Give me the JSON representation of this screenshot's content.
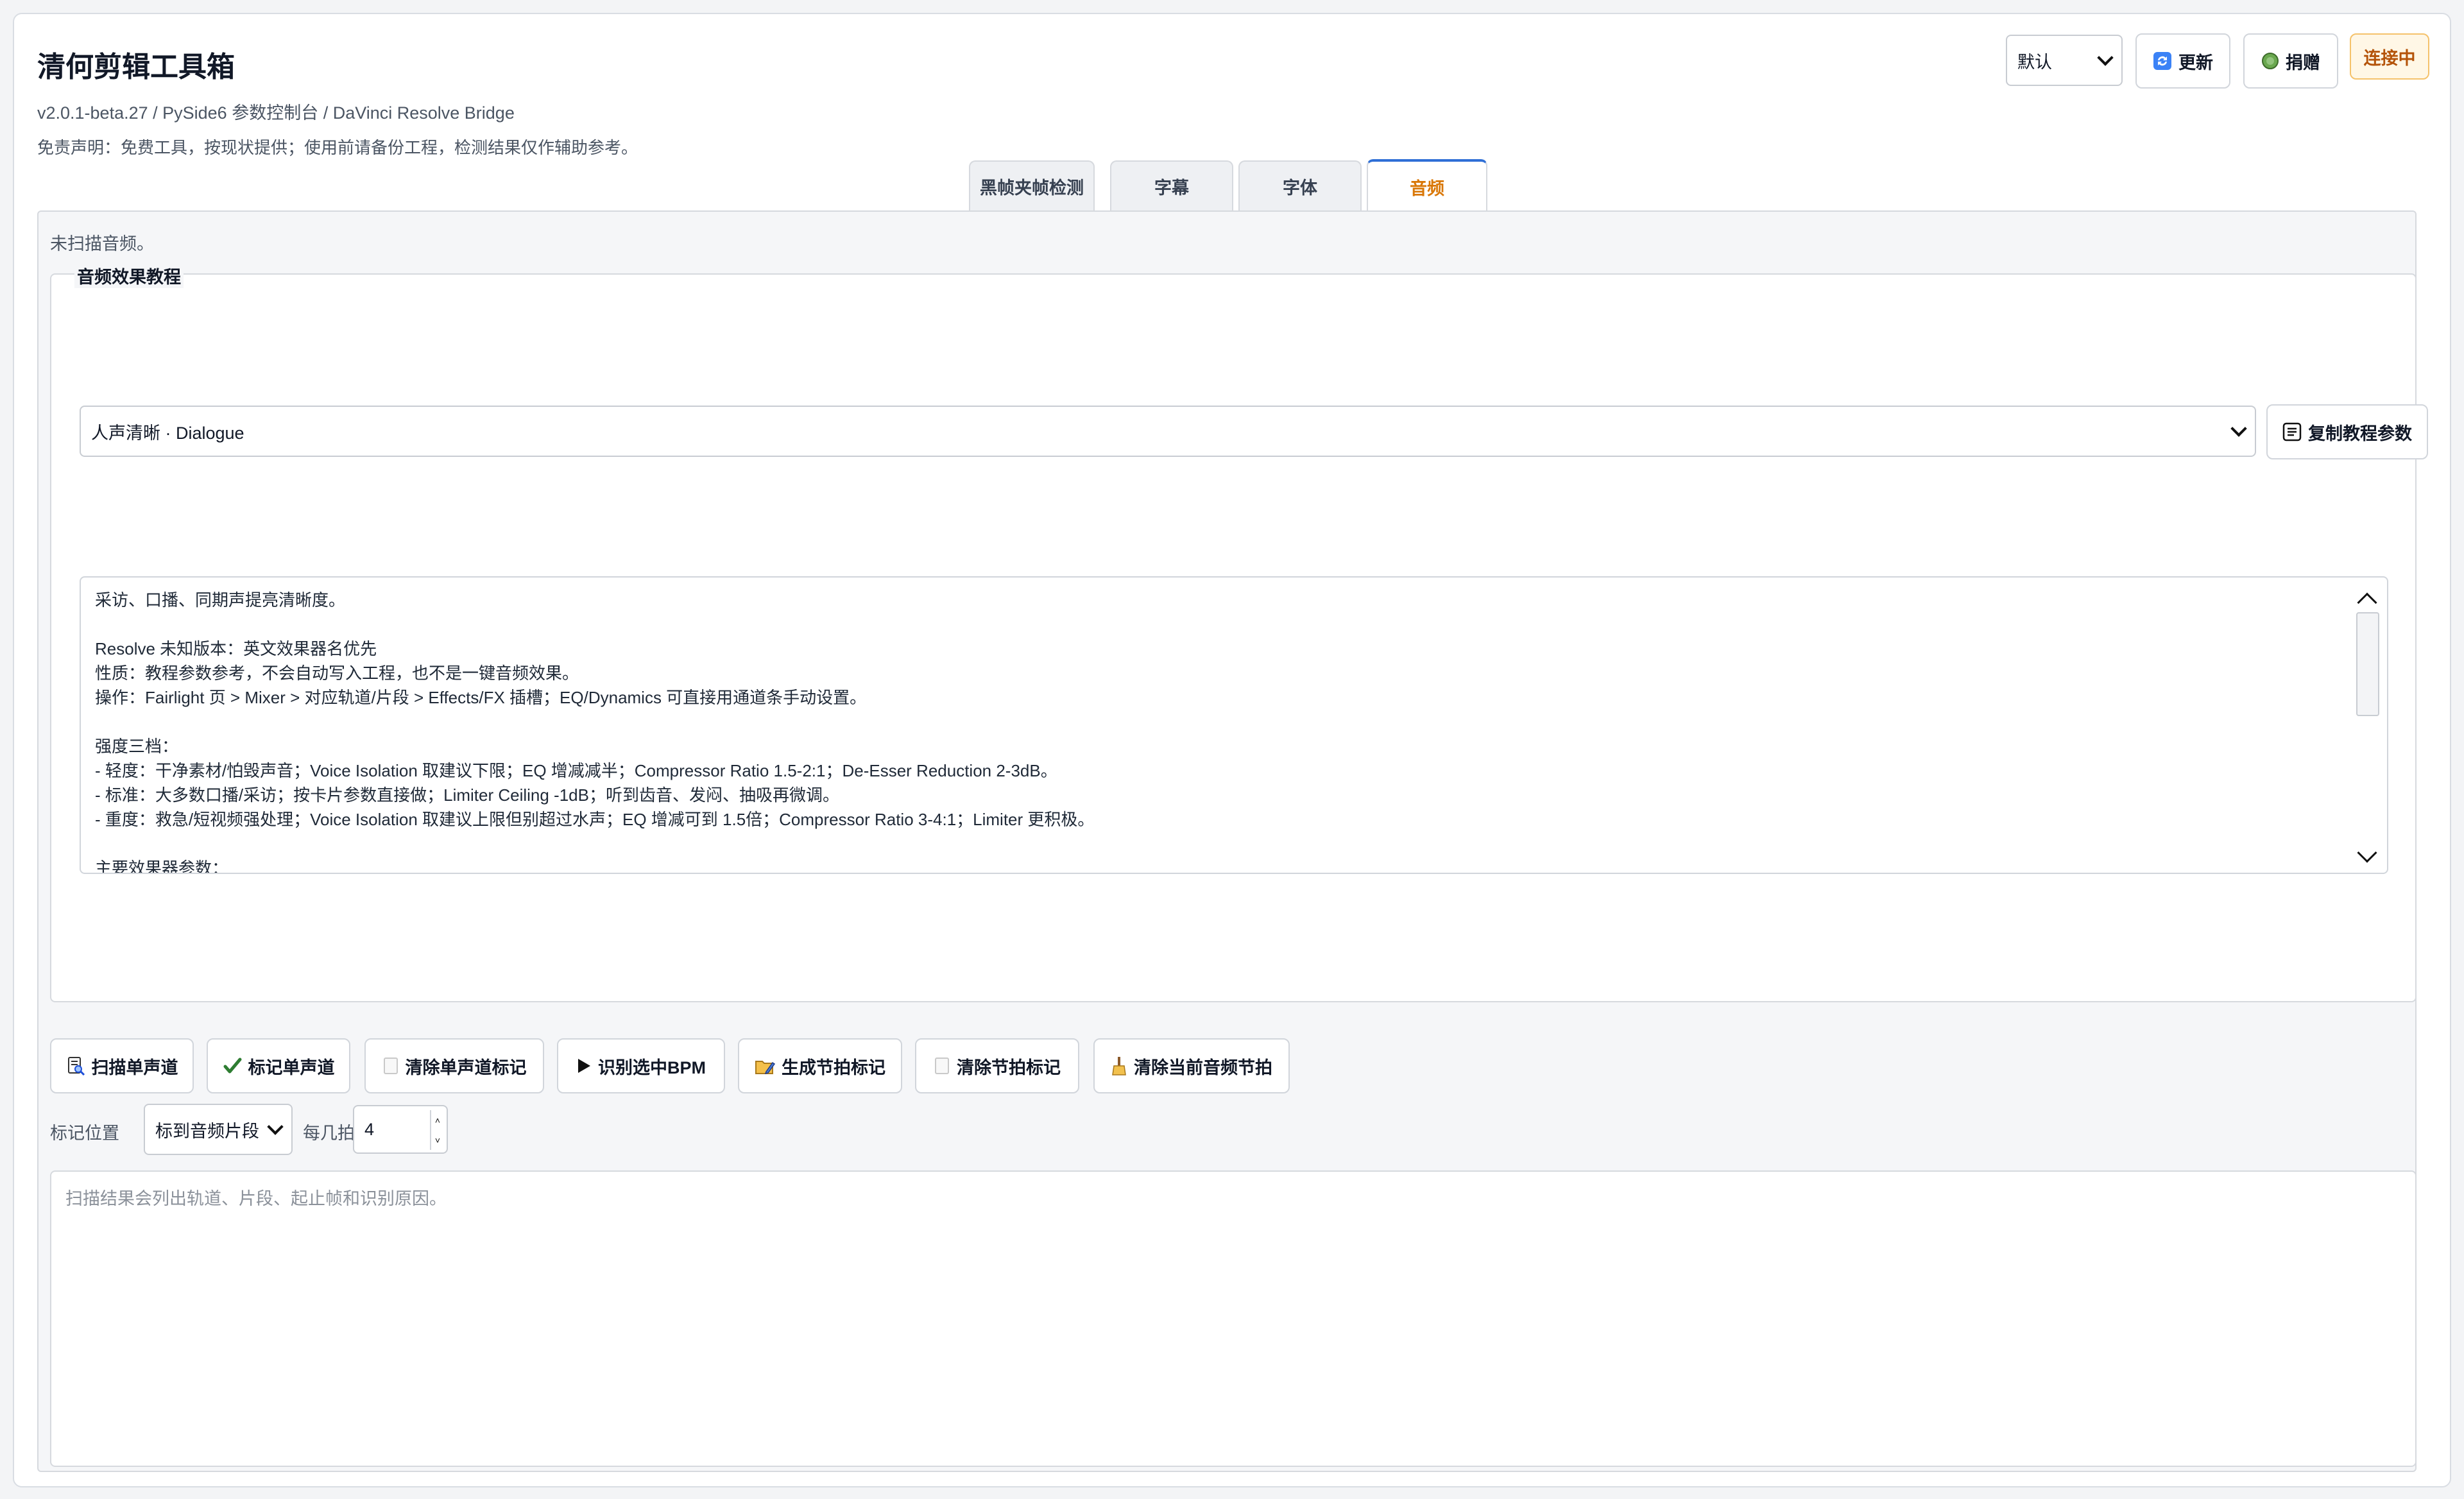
{
  "app": {
    "title": "清何剪辑工具箱",
    "subtitle": "v2.0.1-beta.27 / PySide6 参数控制台 / DaVinci Resolve Bridge",
    "disclaimer": "免责声明：免费工具，按现状提供；使用前请备份工程，检测结果仅作辅助参考。"
  },
  "header": {
    "theme_select": "默认",
    "update_label": "更新",
    "donate_label": "捐赠",
    "connection_status": "连接中"
  },
  "tabs": [
    {
      "label": "黑帧夹帧检测",
      "active": false
    },
    {
      "label": "字幕",
      "active": false
    },
    {
      "label": "字体",
      "active": false
    },
    {
      "label": "音频",
      "active": true
    }
  ],
  "audio": {
    "status": "未扫描音频。",
    "group_title": "音频效果教程",
    "preset_select": "人声清晰 · Dialogue",
    "copy_params_label": "复制教程参数",
    "tutorial_lines": [
      "采访、口播、同期声提亮清晰度。",
      "",
      "Resolve 未知版本：英文效果器名优先",
      "性质：教程参数参考，不会自动写入工程，也不是一键音频效果。",
      "操作：Fairlight 页 > Mixer > 对应轨道/片段 > Effects/FX 插槽；EQ/Dynamics 可直接用通道条手动设置。",
      "",
      "强度三档：",
      "- 轻度：干净素材/怕毁声音；Voice Isolation 取建议下限；EQ 增减减半；Compressor Ratio 1.5-2:1；De-Esser Reduction 2-3dB。",
      "- 标准：大多数口播/采访；按卡片参数直接做；Limiter Ceiling -1dB；听到齿音、发闷、抽吸再微调。",
      "- 重度：救急/短视频强处理；Voice Isolation 取建议上限但别超过水声；EQ 增减可到 1.5倍；Compressor Ratio 3-4:1；Limiter 更积极。",
      "",
      "主要效果器参数："
    ],
    "actions": {
      "scan_single": "扫描单声道",
      "mark_single": "标记单声道",
      "clear_single_marks": "清除单声道标记",
      "detect_bpm": "识别选中BPM",
      "generate_beat_marks": "生成节拍标记",
      "clear_beat_marks": "清除节拍标记",
      "clear_current_beats": "清除当前音频节拍"
    },
    "mark_position_label": "标记位置",
    "mark_position_value": "标到音频片段",
    "beats_label": "每几拍",
    "beats_value": "4",
    "result_placeholder": "扫描结果会列出轨道、片段、起止帧和识别原因。"
  }
}
